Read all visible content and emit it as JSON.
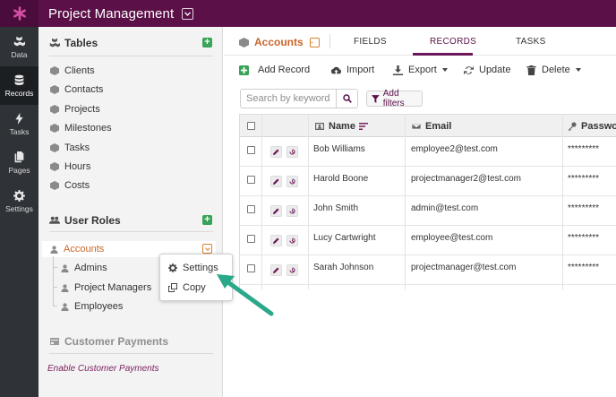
{
  "app": {
    "title": "Project Management",
    "brand_color": "#5b1048",
    "accent_color": "#c8662a",
    "logo_icon": "asterisk-icon"
  },
  "rail": {
    "items": [
      {
        "label": "Data",
        "icon": "cubes-icon"
      },
      {
        "label": "Records",
        "icon": "database-icon",
        "active": true
      },
      {
        "label": "Tasks",
        "icon": "bolt-icon"
      },
      {
        "label": "Pages",
        "icon": "pages-icon"
      },
      {
        "label": "Settings",
        "icon": "gear-icon"
      }
    ]
  },
  "sidebar": {
    "tables_header": "Tables",
    "tables": [
      "Clients",
      "Contacts",
      "Projects",
      "Milestones",
      "Tasks",
      "Hours",
      "Costs"
    ],
    "roles_header": "User Roles",
    "roles": [
      "Accounts",
      "Admins",
      "Project Managers",
      "Employees"
    ],
    "payments_header": "Customer Payments",
    "payments_link": "Enable Customer Payments"
  },
  "context_menu": {
    "items": [
      "Settings",
      "Copy"
    ]
  },
  "main": {
    "object_title": "Accounts",
    "tabs": [
      "FIELDS",
      "RECORDS",
      "TASKS"
    ],
    "active_tab": "RECORDS",
    "toolbar": {
      "add": "Add Record",
      "import": "Import",
      "export": "Export",
      "update": "Update",
      "delete": "Delete"
    },
    "search_placeholder": "Search by keyword",
    "filter_label": "Add filters",
    "columns": [
      "Name",
      "Email",
      "Password"
    ],
    "rows": [
      {
        "name": "Bob Williams",
        "email": "employee2@test.com",
        "password": "*********"
      },
      {
        "name": "Harold Boone",
        "email": "projectmanager2@test.com",
        "password": "*********"
      },
      {
        "name": "John Smith",
        "email": "admin@test.com",
        "password": "*********"
      },
      {
        "name": "Lucy Cartwright",
        "email": "employee@test.com",
        "password": "*********"
      },
      {
        "name": "Sarah Johnson",
        "email": "projectmanager@test.com",
        "password": "*********"
      }
    ]
  },
  "annotation": {
    "arrow_color": "#2aa88a"
  }
}
